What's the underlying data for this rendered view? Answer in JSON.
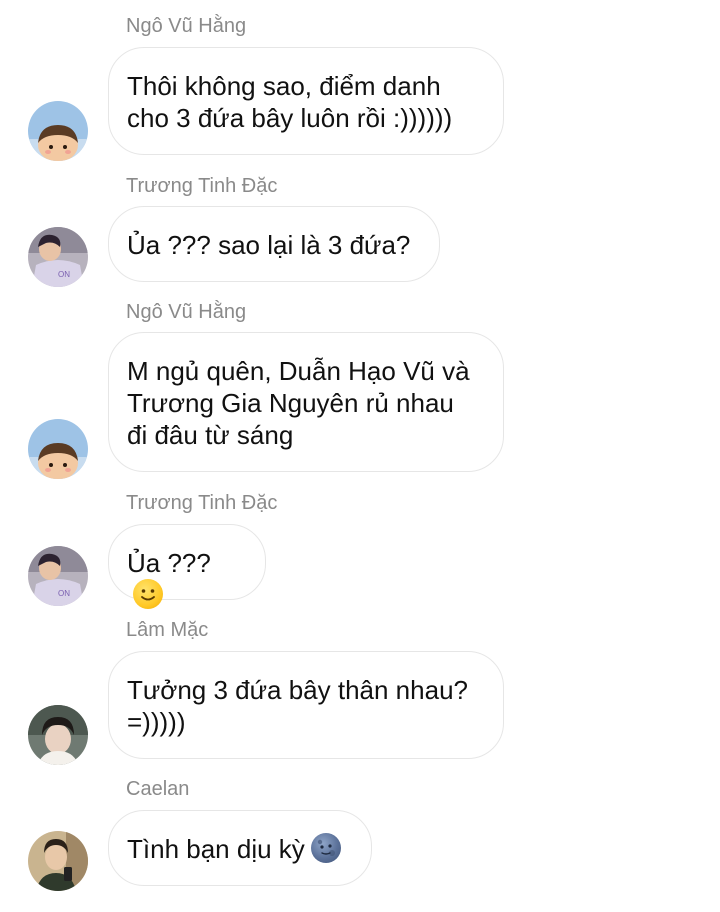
{
  "messages": [
    {
      "sender": "Ngô Vũ Hằng",
      "text": "Thôi không sao, điểm danh\ncho 3 đứa bây luôn rồi :))))))",
      "avatar_icon": "avatar-ngo-vu-hang"
    },
    {
      "sender": "Trương Tinh Đặc",
      "text": "Ủa ??? sao lại là 3 đứa?",
      "avatar_icon": "avatar-truong-tinh-dac"
    },
    {
      "sender": "Ngô Vũ Hằng",
      "text": "M ngủ quên, Duẫn Hạo Vũ và\nTrương Gia Nguyên rủ nhau\nđi đâu từ sáng",
      "avatar_icon": "avatar-ngo-vu-hang"
    },
    {
      "sender": "Trương Tinh Đặc",
      "text": "Ủa ???",
      "emoji": "slightly-smiling-face-icon",
      "avatar_icon": "avatar-truong-tinh-dac"
    },
    {
      "sender": "Lâm Mặc",
      "text": "Tưởng 3 đứa bây thân nhau?\n=)))))",
      "avatar_icon": "avatar-lam-mac"
    },
    {
      "sender": "Caelan",
      "text": "Tình bạn dịu kỳ",
      "emoji": "new-moon-face-icon",
      "avatar_icon": "avatar-caelan"
    }
  ],
  "colors": {
    "background": "#ffffff",
    "sender_name": "#8a8a8a",
    "bubble_border": "#e6e6e6",
    "message_text": "#111111"
  }
}
